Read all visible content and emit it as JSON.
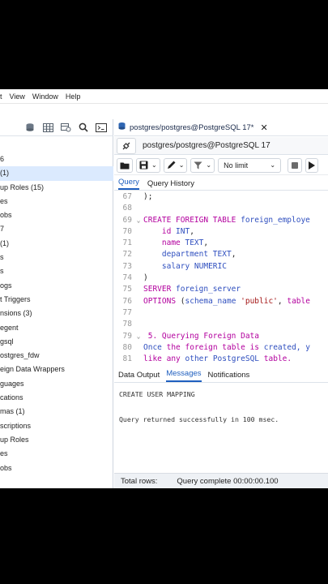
{
  "menu": {
    "items": [
      "View",
      "Window",
      "Help"
    ],
    "partial": "t"
  },
  "tree": {
    "items": [
      {
        "label": "6",
        "selected": false
      },
      {
        "label": "(1)",
        "selected": true
      },
      {
        "label": "up Roles (15)",
        "selected": false
      },
      {
        "label": "es",
        "selected": false
      },
      {
        "label": "obs",
        "selected": false
      },
      {
        "label": "7",
        "selected": false
      },
      {
        "label": "(1)",
        "selected": false
      },
      {
        "label": "s",
        "selected": false
      },
      {
        "label": "s",
        "selected": false
      },
      {
        "label": "ogs",
        "selected": false
      },
      {
        "label": "t Triggers",
        "selected": false
      },
      {
        "label": "nsions (3)",
        "selected": false
      },
      {
        "label": "egent",
        "selected": false
      },
      {
        "label": "gsql",
        "selected": false
      },
      {
        "label": "ostgres_fdw",
        "selected": false
      },
      {
        "label": "eign Data Wrappers",
        "selected": false
      },
      {
        "label": "guages",
        "selected": false
      },
      {
        "label": "cations",
        "selected": false
      },
      {
        "label": "mas (1)",
        "selected": false
      },
      {
        "label": "scriptions",
        "selected": false
      },
      {
        "label": "up Roles",
        "selected": false
      },
      {
        "label": "es",
        "selected": false
      },
      {
        "label": "obs",
        "selected": false
      }
    ]
  },
  "tab": {
    "title": "postgres/postgres@PostgreSQL 17*",
    "close": "✕"
  },
  "connection": {
    "label": "postgres/postgres@PostgreSQL 17"
  },
  "toolbar": {
    "limit": "No limit"
  },
  "subtabs": {
    "query": "Query",
    "history": "Query History"
  },
  "editor": {
    "lines": [
      {
        "num": "67",
        "tokens": [
          {
            "t": ");",
            "c": "code"
          }
        ]
      },
      {
        "num": "68",
        "tokens": []
      },
      {
        "num": "69",
        "fold": "⌄",
        "tokens": [
          {
            "t": "CREATE FOREIGN TABLE ",
            "c": "kw"
          },
          {
            "t": "foreign_employe",
            "c": "id"
          }
        ]
      },
      {
        "num": "70",
        "tokens": [
          {
            "t": "    id ",
            "c": "kw"
          },
          {
            "t": "INT",
            "c": "id"
          },
          {
            "t": ",",
            "c": "code"
          }
        ]
      },
      {
        "num": "71",
        "tokens": [
          {
            "t": "    name ",
            "c": "kw"
          },
          {
            "t": "TEXT",
            "c": "id"
          },
          {
            "t": ",",
            "c": "code"
          }
        ]
      },
      {
        "num": "72",
        "tokens": [
          {
            "t": "    department ",
            "c": "id"
          },
          {
            "t": "TEXT",
            "c": "id"
          },
          {
            "t": ",",
            "c": "code"
          }
        ]
      },
      {
        "num": "73",
        "tokens": [
          {
            "t": "    salary ",
            "c": "id"
          },
          {
            "t": "NUMERIC",
            "c": "id"
          }
        ]
      },
      {
        "num": "74",
        "tokens": [
          {
            "t": ")",
            "c": "code"
          }
        ]
      },
      {
        "num": "75",
        "tokens": [
          {
            "t": "SERVER ",
            "c": "kw"
          },
          {
            "t": "foreign_server",
            "c": "id"
          }
        ]
      },
      {
        "num": "76",
        "tokens": [
          {
            "t": "OPTIONS ",
            "c": "kw"
          },
          {
            "t": "(",
            "c": "code"
          },
          {
            "t": "schema_name ",
            "c": "id"
          },
          {
            "t": "'public'",
            "c": "str"
          },
          {
            "t": ", ",
            "c": "code"
          },
          {
            "t": "table",
            "c": "kw"
          }
        ]
      },
      {
        "num": "77",
        "tokens": []
      },
      {
        "num": "78",
        "tokens": []
      },
      {
        "num": "79",
        "fold": "⌄",
        "tokens": [
          {
            "t": " 5. Querying ",
            "c": "kw"
          },
          {
            "t": "Foreign Data",
            "c": "kw"
          }
        ]
      },
      {
        "num": "80",
        "tokens": [
          {
            "t": "Once ",
            "c": "id"
          },
          {
            "t": "the ",
            "c": "kw"
          },
          {
            "t": "foreign table ",
            "c": "kw"
          },
          {
            "t": "is ",
            "c": "kw"
          },
          {
            "t": "created, y",
            "c": "id"
          }
        ]
      },
      {
        "num": "81",
        "tokens": [
          {
            "t": "like ",
            "c": "kw"
          },
          {
            "t": "any ",
            "c": "kw"
          },
          {
            "t": "other ",
            "c": "id"
          },
          {
            "t": "PostgreSQL ",
            "c": "id"
          },
          {
            "t": "table.",
            "c": "kw"
          }
        ]
      }
    ]
  },
  "results": {
    "tabs": [
      "Data Output",
      "Messages",
      "Notifications"
    ],
    "active": "Messages",
    "messages": [
      "CREATE USER MAPPING",
      "Query returned successfully in 100 msec."
    ]
  },
  "status": {
    "rows_label": "Total rows:",
    "complete": "Query complete 00:00:00.100"
  }
}
